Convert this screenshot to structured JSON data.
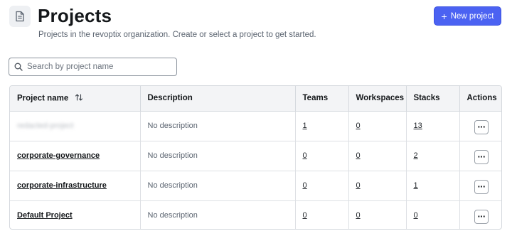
{
  "header": {
    "title": "Projects",
    "subtitle": "Projects in the revoptix organization. Create or select a project to get started.",
    "icon": "document-icon",
    "new_button_label": "New project",
    "new_button_icon": "plus-icon"
  },
  "search": {
    "placeholder": "Search by project name",
    "value": "",
    "icon": "search-icon"
  },
  "table": {
    "columns": {
      "name": "Project name",
      "description": "Description",
      "teams": "Teams",
      "workspaces": "Workspaces",
      "stacks": "Stacks",
      "actions": "Actions"
    },
    "sort_icon": "sort-arrows-icon",
    "rows": [
      {
        "name": "redacted-project",
        "description": "No description",
        "teams": "1",
        "workspaces": "0",
        "stacks": "13",
        "actions": "···"
      },
      {
        "name": "corporate-governance",
        "description": "No description",
        "teams": "0",
        "workspaces": "0",
        "stacks": "2",
        "actions": "···"
      },
      {
        "name": "corporate-infrastructure",
        "description": "No description",
        "teams": "0",
        "workspaces": "0",
        "stacks": "1",
        "actions": "···"
      },
      {
        "name": "Default Project",
        "description": "No description",
        "teams": "0",
        "workspaces": "0",
        "stacks": "0",
        "actions": "···"
      }
    ]
  },
  "colors": {
    "accent": "#4b62f2",
    "header_bg": "#f3f4f6",
    "border": "#d5d9de"
  }
}
